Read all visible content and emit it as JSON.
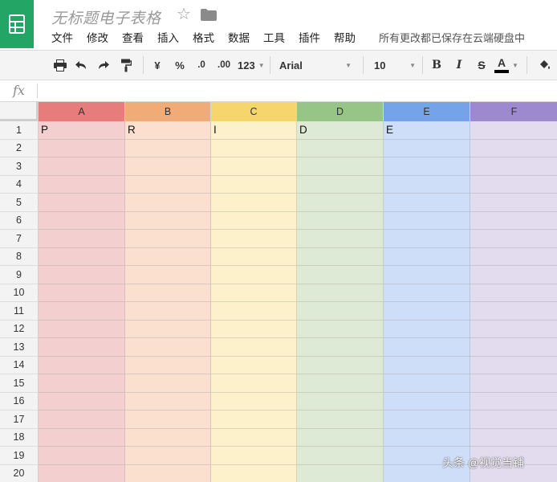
{
  "doc": {
    "title": "无标题电子表格",
    "save_status": "所有更改都已保存在云端硬盘中"
  },
  "menu": [
    "文件",
    "修改",
    "查看",
    "插入",
    "格式",
    "数据",
    "工具",
    "插件",
    "帮助"
  ],
  "toolbar": {
    "currency": "¥",
    "percent": "%",
    "decrease_decimal": ".0",
    "increase_decimal": ".00",
    "more_formats": "123",
    "font": "Arial",
    "font_size": "10",
    "bold": "B",
    "italic": "I",
    "strike": "S",
    "text_color": "A"
  },
  "formula": {
    "label": "fx",
    "value": ""
  },
  "columns": [
    {
      "label": "A",
      "header_color": "#e67c7c",
      "fill_color": "#f3cfd0"
    },
    {
      "label": "B",
      "header_color": "#f1ab76",
      "fill_color": "#fbe0d0"
    },
    {
      "label": "C",
      "header_color": "#f6d56c",
      "fill_color": "#fdf1cc"
    },
    {
      "label": "D",
      "header_color": "#97c587",
      "fill_color": "#dfead6"
    },
    {
      "label": "E",
      "header_color": "#75a3ea",
      "fill_color": "#cfdef8"
    },
    {
      "label": "F",
      "header_color": "#9d89d0",
      "fill_color": "#e3dcef"
    }
  ],
  "rows": [
    "1",
    "2",
    "3",
    "4",
    "5",
    "6",
    "7",
    "8",
    "9",
    "10",
    "11",
    "12",
    "13",
    "14",
    "15",
    "16",
    "17",
    "18",
    "19",
    "20"
  ],
  "cells": [
    [
      "P",
      "R",
      "I",
      "D",
      "E",
      ""
    ]
  ],
  "watermark": "头条 @视觉当铺"
}
